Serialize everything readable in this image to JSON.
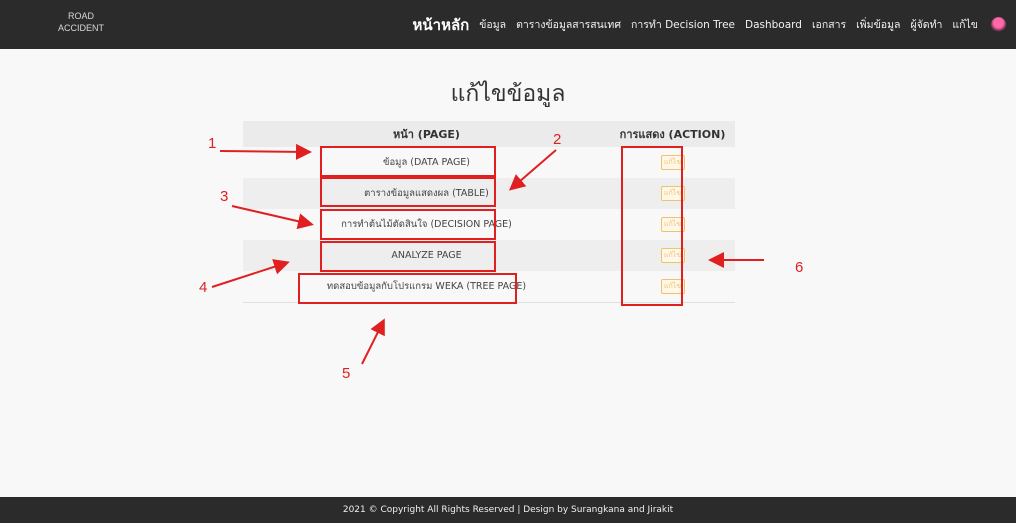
{
  "brand": {
    "line1": "ROAD",
    "line2": "ACCIDENT"
  },
  "nav": {
    "items": [
      {
        "label": "หน้าหลัก",
        "active": true
      },
      {
        "label": "ข้อมูล"
      },
      {
        "label": "ตารางข้อมูลสารสนเทศ"
      },
      {
        "label": "การทำ Decision Tree"
      },
      {
        "label": "Dashboard"
      },
      {
        "label": "เอกสาร"
      },
      {
        "label": "เพิ่มข้อมูล"
      },
      {
        "label": "ผู้จัดทำ"
      },
      {
        "label": "แก้ไข"
      }
    ]
  },
  "page": {
    "title": "แก้ไขข้อมูล"
  },
  "table": {
    "headers": {
      "page": "หน้า (PAGE)",
      "action": "การแสดง (ACTION)"
    },
    "rows": [
      {
        "page": "ข้อมูล (DATA PAGE)",
        "action": "แก้ไข"
      },
      {
        "page": "ตารางข้อมูลแสดงผล (TABLE)",
        "action": "แก้ไข"
      },
      {
        "page": "การทำต้นไม้ตัดสินใจ (DECISION PAGE)",
        "action": "แก้ไข"
      },
      {
        "page": "ANALYZE PAGE",
        "action": "แก้ไข"
      },
      {
        "page": "ทดสอบข้อมูลกับโปรแกรม WEKA (TREE PAGE)",
        "action": "แก้ไข"
      }
    ]
  },
  "annotations": {
    "n1": "1",
    "n2": "2",
    "n3": "3",
    "n4": "4",
    "n5": "5",
    "n6": "6"
  },
  "footer": {
    "text": "2021 © Copyright All Rights Reserved | Design by Surangkana and Jirakit"
  },
  "colors": {
    "annotation": "#e02020",
    "topbar": "#2b2b2b",
    "edit_button": "#f0c36b"
  }
}
